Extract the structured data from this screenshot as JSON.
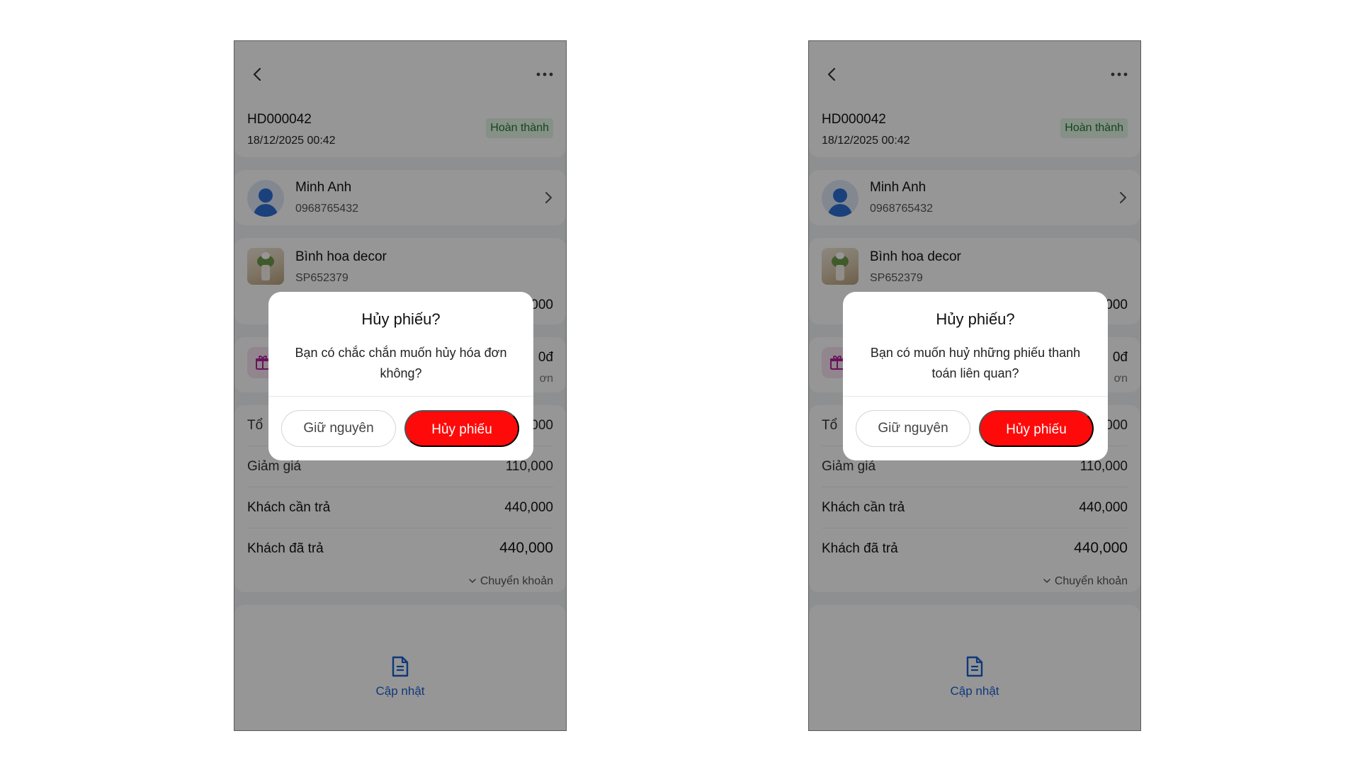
{
  "screens": [
    {
      "order": {
        "code": "HD000042",
        "datetime": "18/12/2025 00:42",
        "status": "Hoàn thành"
      },
      "customer": {
        "name": "Minh Anh",
        "phone": "0968765432"
      },
      "product": {
        "name": "Bình hoa decor",
        "sku": "SP652379",
        "price_visible": "000"
      },
      "promo": {
        "value_visible": "0đ",
        "sub_visible": "ơn"
      },
      "summary": {
        "total_label_visible": "Tổ",
        "total_value_visible": "000",
        "discount_label": "Giảm giá",
        "discount_value": "110,000",
        "due_label": "Khách cần trả",
        "due_value": "440,000",
        "paid_label": "Khách đã trả",
        "paid_value": "440,000",
        "payment_method": "Chuyển khoản"
      },
      "bottom": {
        "update_label": "Cập nhật"
      },
      "dialog": {
        "title": "Hủy phiếu?",
        "message": "Bạn có chắc chắn muốn hủy hóa đơn không?",
        "keep_label": "Giữ nguyên",
        "cancel_label": "Hủy phiếu"
      }
    },
    {
      "order": {
        "code": "HD000042",
        "datetime": "18/12/2025 00:42",
        "status": "Hoàn thành"
      },
      "customer": {
        "name": "Minh Anh",
        "phone": "0968765432"
      },
      "product": {
        "name": "Bình hoa decor",
        "sku": "SP652379",
        "price_visible": "000"
      },
      "promo": {
        "value_visible": "0đ",
        "sub_visible": "ơn"
      },
      "summary": {
        "total_label_visible": "Tổ",
        "total_value_visible": "000",
        "discount_label": "Giảm giá",
        "discount_value": "110,000",
        "due_label": "Khách cần trả",
        "due_value": "440,000",
        "paid_label": "Khách đã trả",
        "paid_value": "440,000",
        "payment_method": "Chuyển khoản"
      },
      "bottom": {
        "update_label": "Cập nhật"
      },
      "dialog": {
        "title": "Hủy phiếu?",
        "message": "Bạn có muốn huỷ những phiếu thanh toán liên quan?",
        "keep_label": "Giữ nguyên",
        "cancel_label": "Hủy phiếu"
      }
    }
  ],
  "colors": {
    "accent_blue": "#1a5fd0",
    "danger_red": "#ff0a0a",
    "status_green_bg": "#e3f5e6",
    "status_green_text": "#1f7a34",
    "overlay": "rgba(0,0,0,0.41)"
  },
  "icons": [
    "back-icon",
    "more-icon",
    "avatar",
    "chevron-right-icon",
    "product-thumbnail",
    "gift-icon",
    "chevron-down-icon",
    "document-icon"
  ]
}
